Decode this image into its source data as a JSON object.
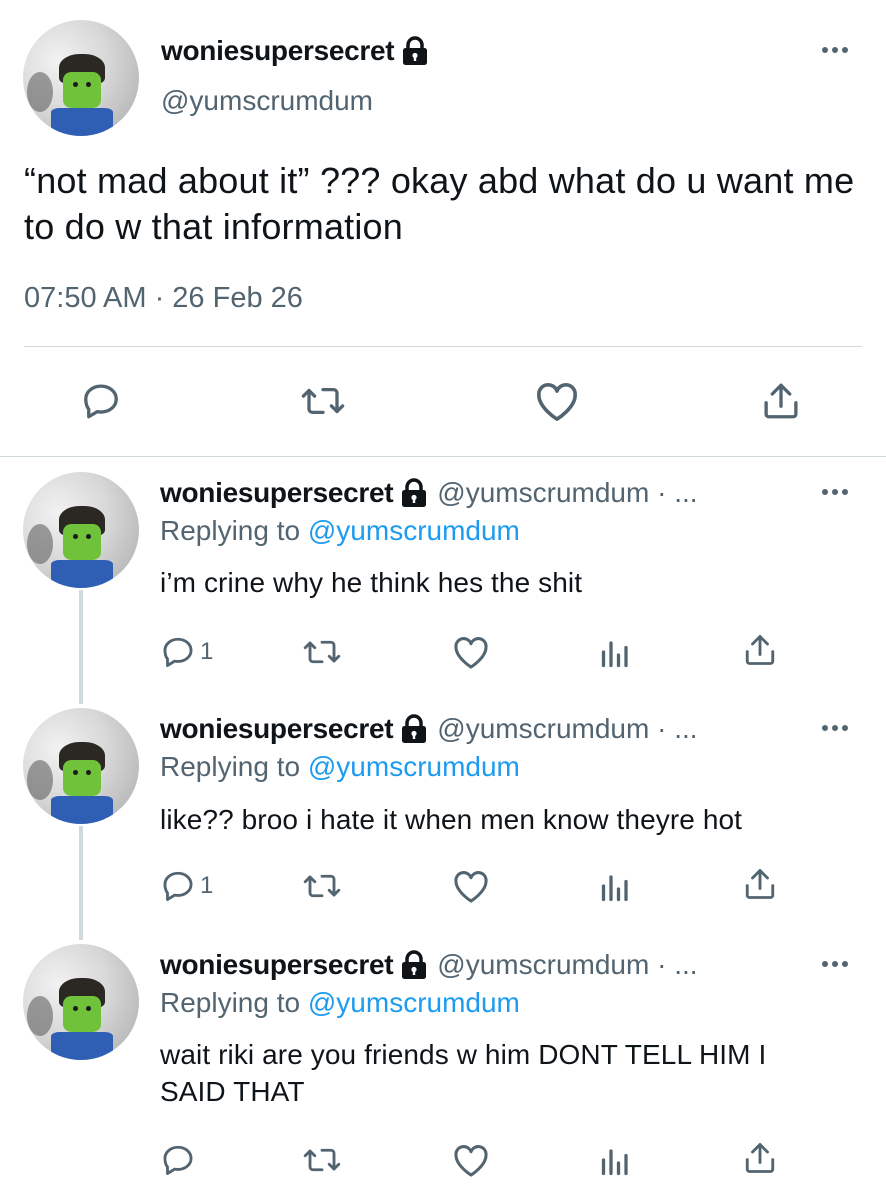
{
  "main_tweet": {
    "display_name": "woniesupersecret",
    "handle": "@yumscrumdum",
    "text": "“not mad about it” ??? okay abd what do u want me to do w that information",
    "timestamp": "07:50 AM · 26 Feb 26"
  },
  "replies": [
    {
      "display_name": "woniesupersecret",
      "handle": "@yumscrumdum · ...",
      "replying_prefix": "Replying to ",
      "replying_to": "@yumscrumdum",
      "text": "i’m crine why he think hes the shit",
      "reply_count": "1"
    },
    {
      "display_name": "woniesupersecret",
      "handle": "@yumscrumdum · ...",
      "replying_prefix": "Replying to ",
      "replying_to": "@yumscrumdum",
      "text": "like?? broo i hate it when men know theyre hot",
      "reply_count": "1"
    },
    {
      "display_name": "woniesupersecret",
      "handle": "@yumscrumdum · ...",
      "replying_prefix": "Replying to ",
      "replying_to": "@yumscrumdum",
      "text": "wait riki are you friends w him DONT TELL HIM I SAID THAT",
      "reply_count": ""
    }
  ],
  "colors": {
    "text": "#0f1419",
    "secondary": "#536471",
    "link": "#1d9bf0",
    "divider": "#cfd9de"
  },
  "icons": {
    "verified_lock": "lock-icon",
    "more": "more-icon",
    "reply": "reply-icon",
    "retweet": "retweet-icon",
    "like": "heart-icon",
    "share": "share-icon",
    "views": "views-icon"
  }
}
